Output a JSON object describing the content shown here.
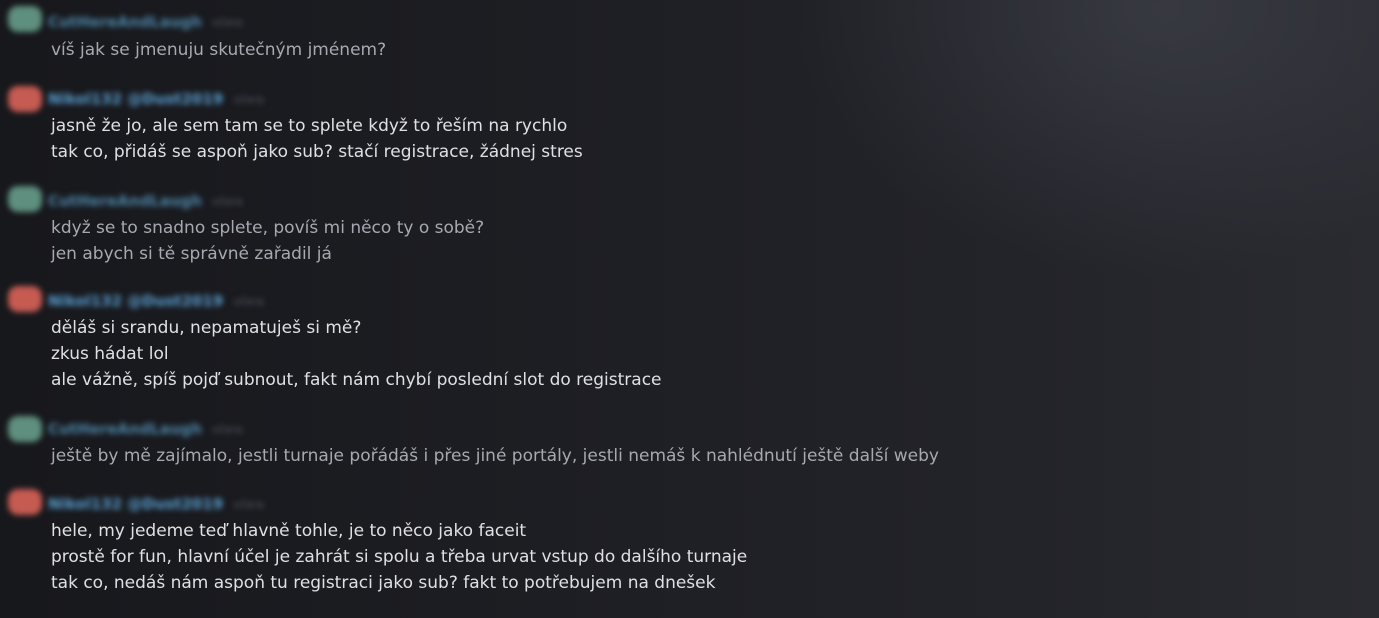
{
  "messages": [
    {
      "author": "CutHereAndLaugh",
      "time": "včera",
      "lines": [
        "víš jak se jmenuju skutečným jménem?"
      ]
    },
    {
      "author": "Nikol132 @Dust2019",
      "time": "včera",
      "lines": [
        "jasně že jo, ale sem tam se to splete když to řeším na rychlo",
        "tak co, přidáš se aspoň jako sub? stačí registrace, žádnej stres"
      ]
    },
    {
      "author": "CutHereAndLaugh",
      "time": "včera",
      "lines": [
        "když se to snadno splete, povíš mi něco ty o sobě?",
        "jen abych si tě správně zařadil já"
      ]
    },
    {
      "author": "Nikol132 @Dust2019",
      "time": "včera",
      "lines": [
        "děláš si srandu, nepamatuješ si mě?",
        "zkus hádat lol",
        "ale vážně, spíš pojď subnout, fakt nám chybí poslední slot do registrace"
      ]
    },
    {
      "author": "CutHereAndLaugh",
      "time": "včera",
      "lines": [
        "ještě by mě zajímalo, jestli turnaje pořádáš i přes jiné portály, jestli nemáš k nahlédnutí ještě další weby"
      ]
    },
    {
      "author": "Nikol132 @Dust2019",
      "time": "včera",
      "lines": [
        "hele, my jedeme teď hlavně tohle, je to něco jako faceit",
        "prostě for fun, hlavní účel je zahrát si spolu a třeba urvat vstup do dalšího turnaje",
        "tak co, nedáš nám aspoň tu registraci jako sub? fakt to potřebujem na dnešek"
      ]
    }
  ]
}
